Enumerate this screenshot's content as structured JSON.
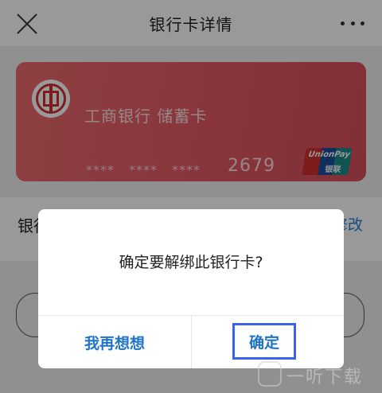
{
  "header": {
    "title": "银行卡详情",
    "close_icon": "close-icon",
    "more_icon": "more-dots-icon"
  },
  "card": {
    "bank_name": "工商银行  储蓄卡",
    "mask_group_1": "****",
    "mask_group_2": "****",
    "mask_group_3": "****",
    "last_four": "2679",
    "network_logo_text": "UnionPay",
    "network_logo_cn": "银联",
    "colors": {
      "gradient_start": "#ec6b6f",
      "gradient_end": "#d84f5d"
    }
  },
  "detail_row": {
    "label": "银行",
    "action": "修改"
  },
  "dialog": {
    "message": "确定要解绑此银行卡?",
    "cancel_label": "我再想想",
    "confirm_label": "确定",
    "accent_color": "#1f74c8"
  },
  "watermark": {
    "text": "一听下载"
  }
}
